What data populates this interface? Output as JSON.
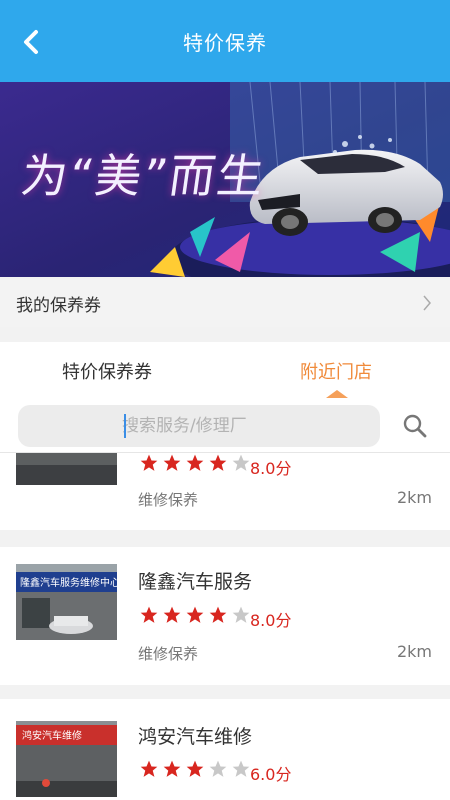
{
  "header": {
    "title": "特价保养",
    "back_icon": "chevron-left-icon"
  },
  "banner": {
    "slogan": "为“美”而生",
    "tag_text": "",
    "accent_color": "#ff3fa8"
  },
  "coupon_entry": {
    "label": "我的保养券",
    "icon": "chevron-right-icon"
  },
  "tabs": [
    {
      "label": "特价保养券",
      "active": false
    },
    {
      "label": "附近门店",
      "active": true
    }
  ],
  "active_color": "#f08a3a",
  "search": {
    "value": "",
    "placeholder": "搜索服务/修理厂",
    "icon": "search-icon"
  },
  "shops": [
    {
      "name": "",
      "rating": 4,
      "score": "8.0分",
      "tag": "维修保养",
      "distance": "2km"
    },
    {
      "name": "隆鑫汽车服务",
      "rating": 4,
      "score": "8.0分",
      "tag": "维修保养",
      "distance": "2km"
    },
    {
      "name": "鸿安汽车维修",
      "rating": 3,
      "score": "6.0分",
      "tag": "",
      "distance": ""
    }
  ],
  "colors": {
    "topbar": "#2fa8ec",
    "star_on": "#d8261f",
    "star_off": "#c8c8c8"
  }
}
